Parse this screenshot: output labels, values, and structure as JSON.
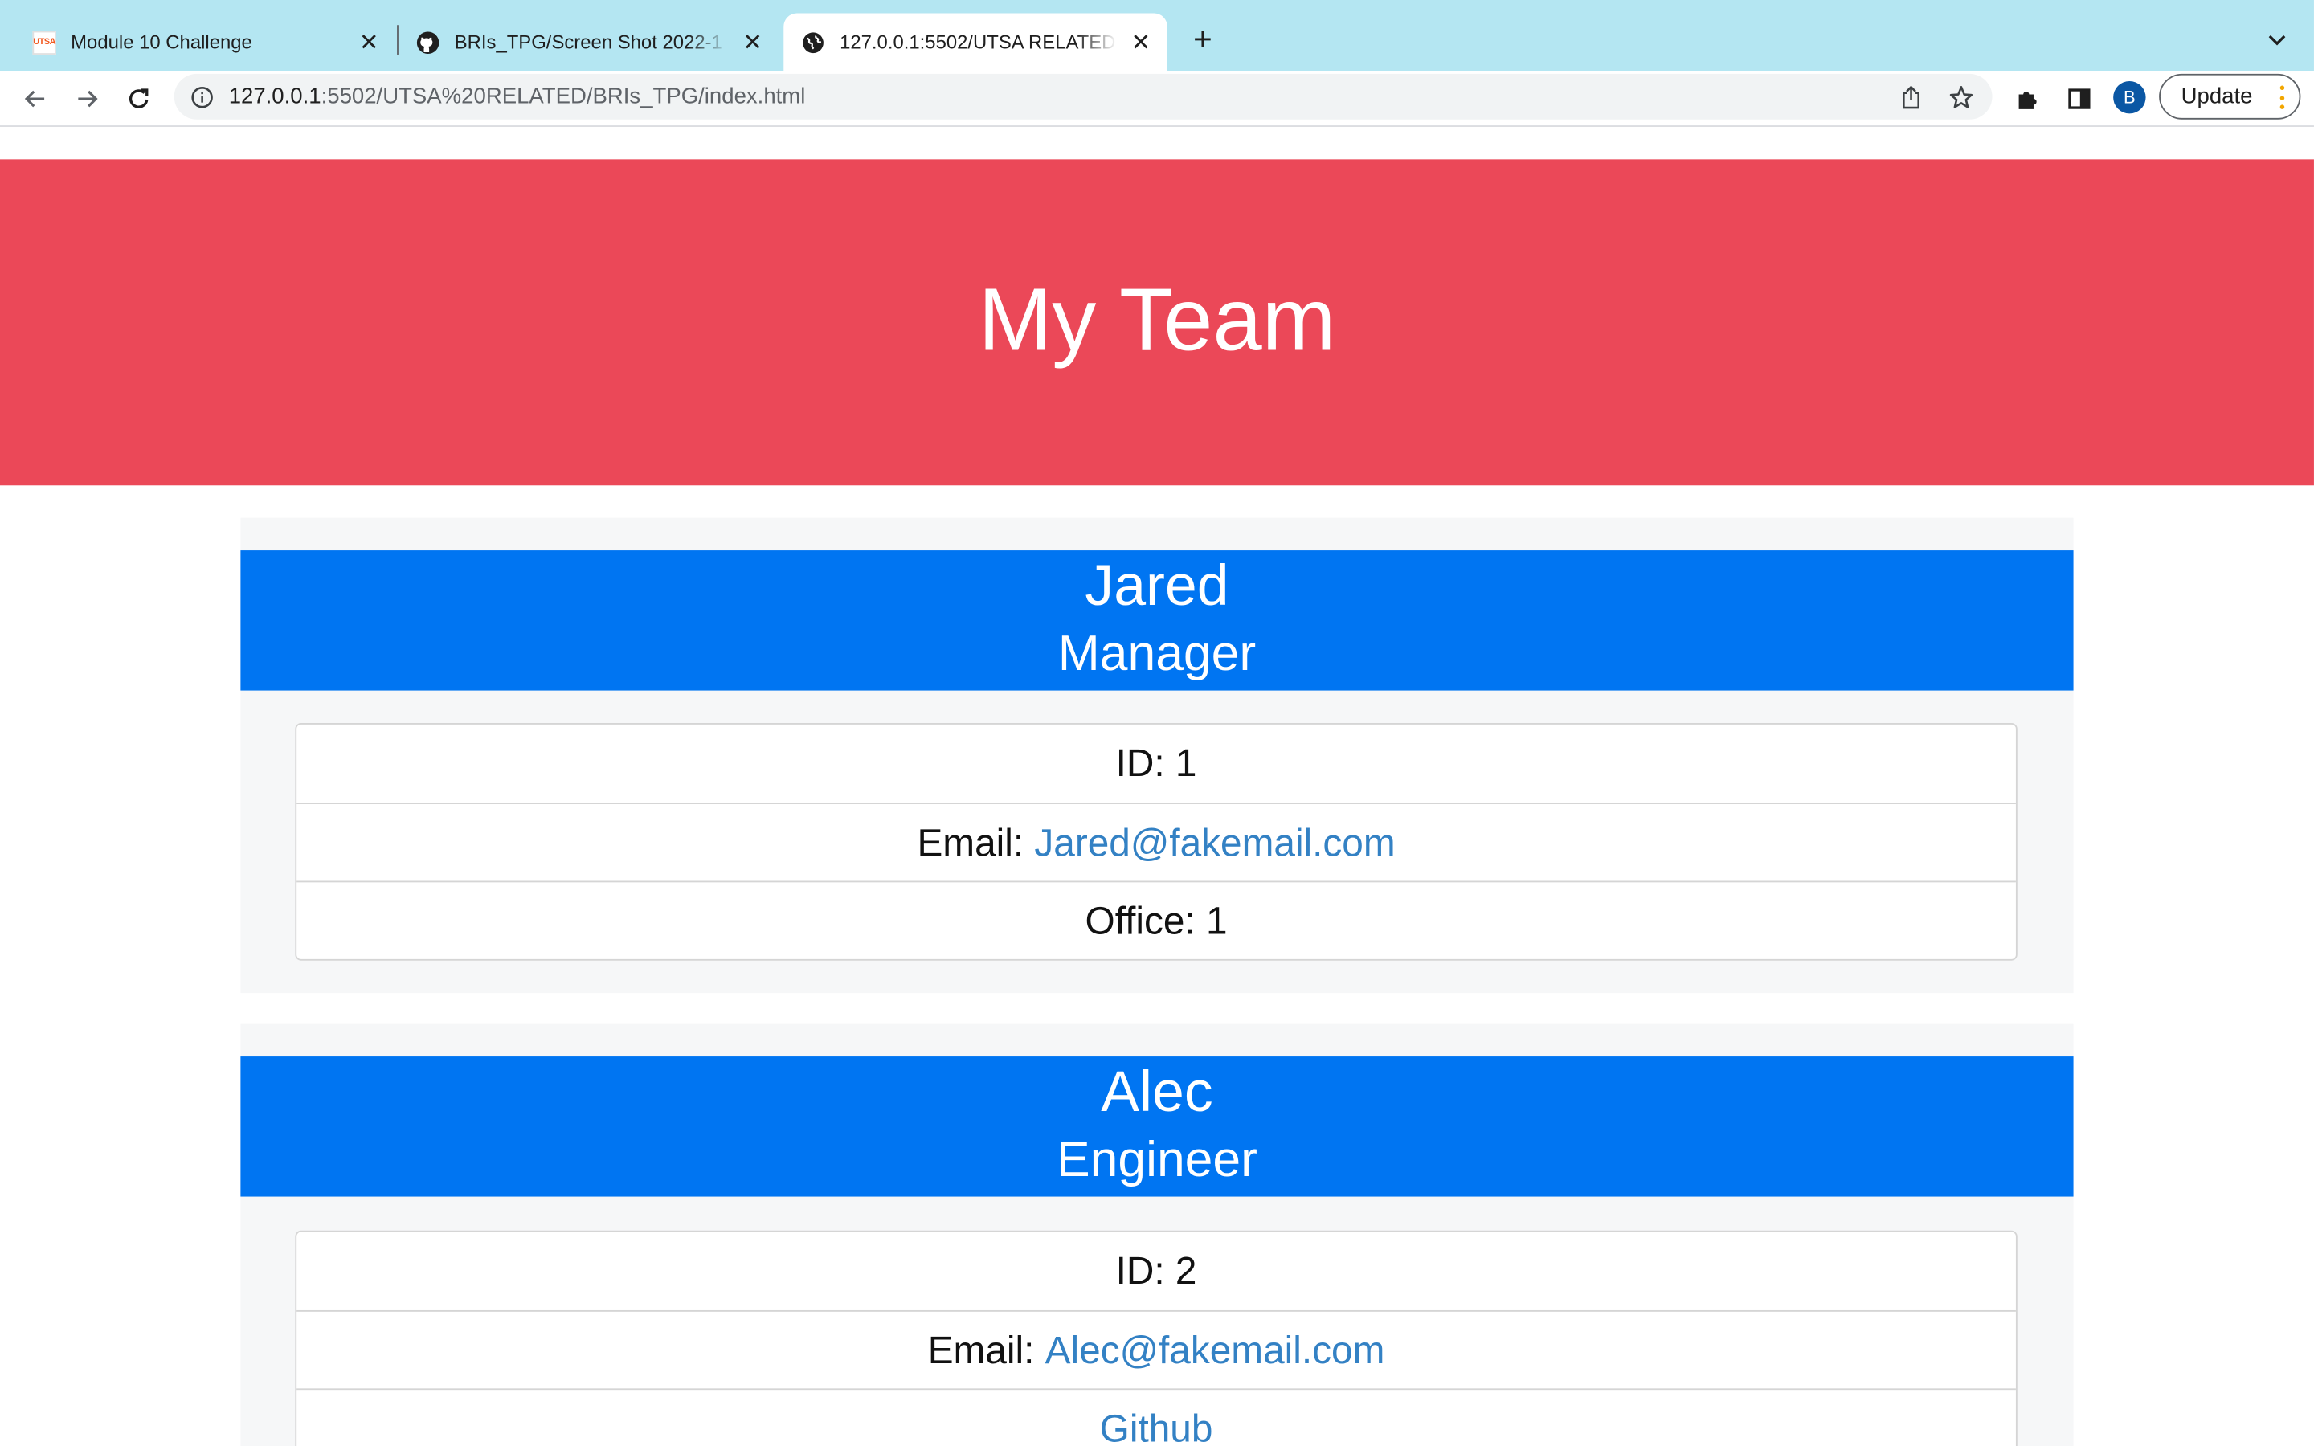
{
  "browser": {
    "tabs": [
      {
        "title": "Module 10 Challenge",
        "favicon": "utsa-icon",
        "active": false
      },
      {
        "title": "BRIs_TPG/Screen Shot 2022-1",
        "favicon": "github-icon",
        "active": false
      },
      {
        "title": "127.0.0.1:5502/UTSA RELATED",
        "favicon": "globe-icon",
        "active": true
      }
    ],
    "utsa_favicon_text": "UTSA",
    "new_tab_glyph": "+",
    "close_glyph": "✕",
    "address": {
      "host": "127.0.0.1",
      "rest": ":5502/UTSA%20RELATED/BRIs_TPG/index.html"
    },
    "profile_initial": "B",
    "update_label": "Update",
    "colors": {
      "tabstrip": "#b4e6f2",
      "omnibox": "#f1f3f4"
    }
  },
  "page": {
    "title": "My Team",
    "colors": {
      "header": "#eb4858",
      "card_head": "#0075f2",
      "card_body": "#f6f7f8",
      "link": "#3381c4"
    },
    "employees": [
      {
        "name": "Jared",
        "role": "Manager",
        "id_label": "ID: 1",
        "email_label": "Email: ",
        "email": "Jared@fakemail.com",
        "office_label": "Office: 1"
      },
      {
        "name": "Alec",
        "role": "Engineer",
        "id_label": "ID: 2",
        "email_label": "Email: ",
        "email": "Alec@fakemail.com",
        "github_label": "Github"
      }
    ]
  }
}
